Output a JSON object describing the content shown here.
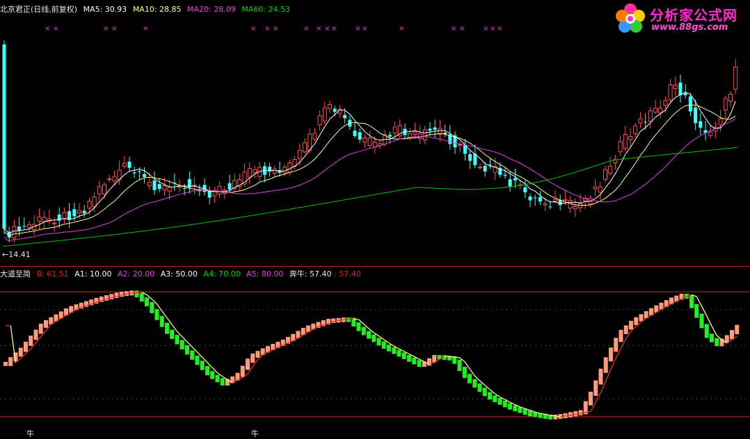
{
  "top_panel": {
    "title": "北京君正(日线,前复权)",
    "ma5_label": "MA5: 30.93",
    "ma10_label": "MA10: 28.85",
    "ma20_label": "MA20: 28.09",
    "ma60_label": "MA60: 24.53",
    "low_price_label": "←14.41",
    "marker_glyph": "×",
    "colors": {
      "ma5": "#ffffff",
      "ma10": "#ffff80",
      "ma20": "#e040e0",
      "ma60": "#00c000",
      "up": "#ff5050",
      "down": "#40ffff"
    }
  },
  "bottom_panel": {
    "title": "大道至简",
    "b_label": "B: 61.51",
    "a1_label": "A1: 10.00",
    "a2_label": "A2: 20.00",
    "a3_label": "A3: 50.00",
    "a4_label": "A4: 70.00",
    "a5_label": "A5: 80.00",
    "benniu_label": "奔牛: 57.40",
    "benniu_value_label": ": 57.40",
    "signal_glyph": "牛",
    "levels": {
      "a1": 10,
      "a2": 20,
      "a3": 50,
      "a4": 70,
      "a5": 80
    },
    "colors": {
      "rising_bar": "#ff9a7a",
      "falling_bar": "#22ee22",
      "signal_line_up": "#e03030",
      "signal_line_down": "#ffff80",
      "level_line": "#e02020"
    }
  },
  "watermark": {
    "title": "分析家公式网",
    "url": "www.88gs.com",
    "icon": "flower-logo-icon"
  },
  "chart_data": [
    {
      "type": "candlestick",
      "title": "北京君正(日线,前复权)",
      "series": [
        {
          "name": "MA5",
          "last": 30.93
        },
        {
          "name": "MA10",
          "last": 28.85
        },
        {
          "name": "MA20",
          "last": 28.09
        },
        {
          "name": "MA60",
          "last": 24.53
        }
      ],
      "annotations": [
        "←14.41"
      ]
    },
    {
      "type": "bar",
      "title": "大道至简",
      "series": [
        {
          "name": "B",
          "last": 61.51
        },
        {
          "name": "奔牛",
          "last": 57.4
        }
      ],
      "levels": [
        10,
        20,
        50,
        70,
        80
      ]
    }
  ]
}
